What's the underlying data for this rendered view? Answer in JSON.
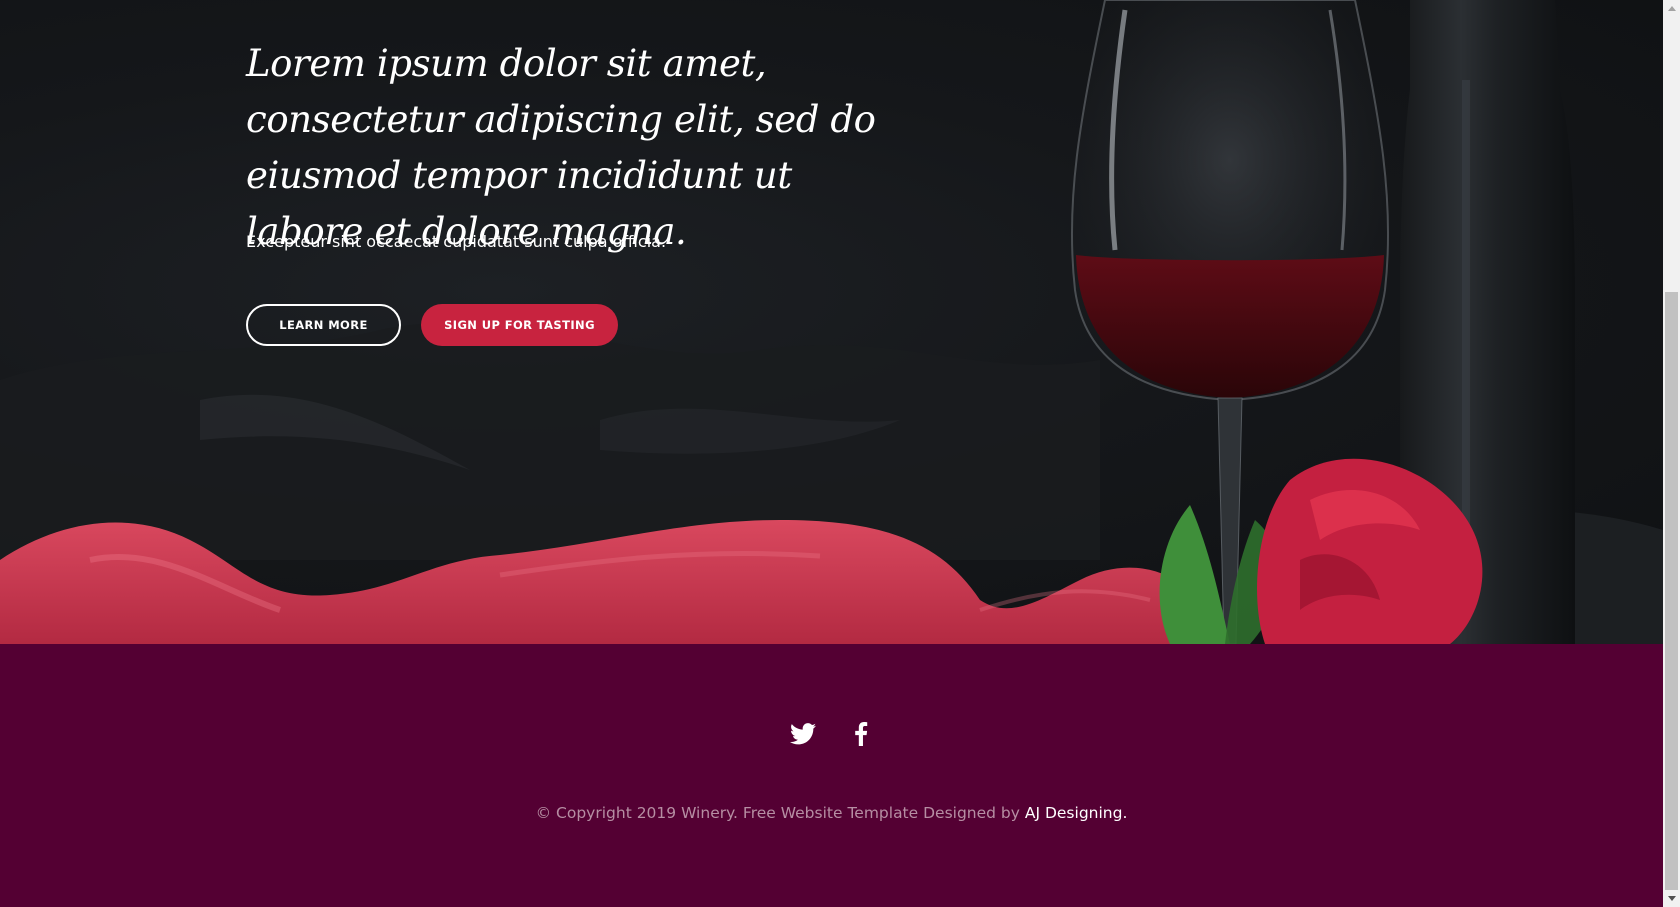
{
  "hero": {
    "title": "Lorem ipsum dolor sit amet, consectetur adipiscing elit, sed do eiusmod tempor incididunt ut labore et dolore magna.",
    "subtitle": "Excepteur sint occaecat cupidatat sunt culpa officia.",
    "learn_more_label": "LEARN MORE",
    "signup_label": "SIGN UP FOR TASTING",
    "background_image": "wine glass, bottle, red rose and red silk on dark background"
  },
  "footer": {
    "social": [
      {
        "icon": "twitter-icon"
      },
      {
        "icon": "facebook-icon"
      }
    ],
    "copyright_text": "© Copyright 2019 Winery. Free Website Template Designed by ",
    "designer_link": "AJ Designing."
  },
  "colors": {
    "accent": "#c8233f",
    "footer_bg": "#540033",
    "hero_bg": "#15171a",
    "copyright_text": "#b68ea3"
  }
}
